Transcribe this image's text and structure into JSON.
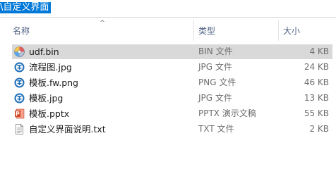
{
  "address": {
    "path": "\\自定义界面"
  },
  "columns": {
    "name": "名称",
    "type": "类型",
    "size": "大小"
  },
  "sort": {
    "column": "name",
    "indicator": "^"
  },
  "files": [
    {
      "name": "udf.bin",
      "type": "BIN 文件",
      "size": "4 KB",
      "icon": "disc-icon",
      "selected": true
    },
    {
      "name": "流程图.jpg",
      "type": "JPG 文件",
      "size": "24 KB",
      "icon": "image-viewer-icon",
      "selected": false
    },
    {
      "name": "模板.fw.png",
      "type": "PNG 文件",
      "size": "46 KB",
      "icon": "image-viewer-icon",
      "selected": false
    },
    {
      "name": "模板.jpg",
      "type": "JPG 文件",
      "size": "13 KB",
      "icon": "image-viewer-icon",
      "selected": false
    },
    {
      "name": "模板.pptx",
      "type": "PPTX 演示文稿",
      "size": "55 KB",
      "icon": "powerpoint-icon",
      "selected": false
    },
    {
      "name": "自定义界面说明.txt",
      "type": "TXT 文件",
      "size": "2 KB",
      "icon": "text-document-icon",
      "selected": false
    }
  ],
  "colors": {
    "accent": "#0078d7",
    "selected_row": "#d9d9d9",
    "header_text": "#4d6082",
    "secondary_text": "#6d6d6d"
  }
}
